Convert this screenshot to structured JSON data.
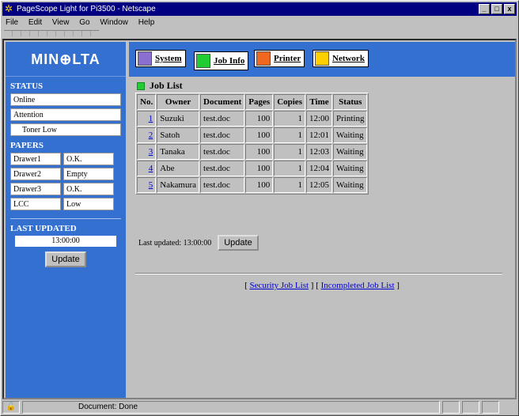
{
  "window": {
    "title": "PageScope Light for Pi3500 - Netscape",
    "icon": "netscape-icon",
    "buttons": {
      "minimize": "_",
      "maximize": "□",
      "close": "x"
    }
  },
  "menu": [
    "File",
    "Edit",
    "View",
    "Go",
    "Window",
    "Help"
  ],
  "sidebar": {
    "logo": "MIN⊕LTA",
    "status_heading": "STATUS",
    "status_items": [
      "Online",
      "Attention",
      "Toner Low"
    ],
    "papers_heading": "PAPERS",
    "papers": [
      {
        "name": "Drawer1",
        "state": "O.K."
      },
      {
        "name": "Drawer2",
        "state": "Empty"
      },
      {
        "name": "Drawer3",
        "state": "O.K."
      },
      {
        "name": "LCC",
        "state": "Low"
      }
    ],
    "last_updated_heading": "LAST UPDATED",
    "last_updated_time": "13:00:00",
    "update_button": "Update"
  },
  "tabs": [
    {
      "label": "System",
      "color": "#8a6fd0"
    },
    {
      "label": "Job Info",
      "color": "#22cc33"
    },
    {
      "label": "Printer",
      "color": "#f06820"
    },
    {
      "label": "Network",
      "color": "#ffd000"
    }
  ],
  "main": {
    "title": "Job List",
    "title_color": "#22cc33",
    "columns": [
      "No.",
      "Owner",
      "Document",
      "Pages",
      "Copies",
      "Time",
      "Status"
    ],
    "rows": [
      {
        "no": "1",
        "owner": "Suzuki",
        "document": "test.doc",
        "pages": "100",
        "copies": "1",
        "time": "12:00",
        "status": "Printing"
      },
      {
        "no": "2",
        "owner": "Satoh",
        "document": "test.doc",
        "pages": "100",
        "copies": "1",
        "time": "12:01",
        "status": "Waiting"
      },
      {
        "no": "3",
        "owner": "Tanaka",
        "document": "test.doc",
        "pages": "100",
        "copies": "1",
        "time": "12:03",
        "status": "Waiting"
      },
      {
        "no": "4",
        "owner": "Abe",
        "document": "test.doc",
        "pages": "100",
        "copies": "1",
        "time": "12:04",
        "status": "Waiting"
      },
      {
        "no": "5",
        "owner": "Nakamura",
        "document": "test.doc",
        "pages": "100",
        "copies": "1",
        "time": "12:05",
        "status": "Waiting"
      }
    ],
    "last_updated_label": "Last updated: 13:00:00",
    "update_button": "Update",
    "link_open": "[",
    "link_sep": "] [",
    "link_close": "]",
    "security_link": "Security Job List",
    "incompleted_link": "Incompleted Job List"
  },
  "statusbar": {
    "text": "Document: Done"
  }
}
